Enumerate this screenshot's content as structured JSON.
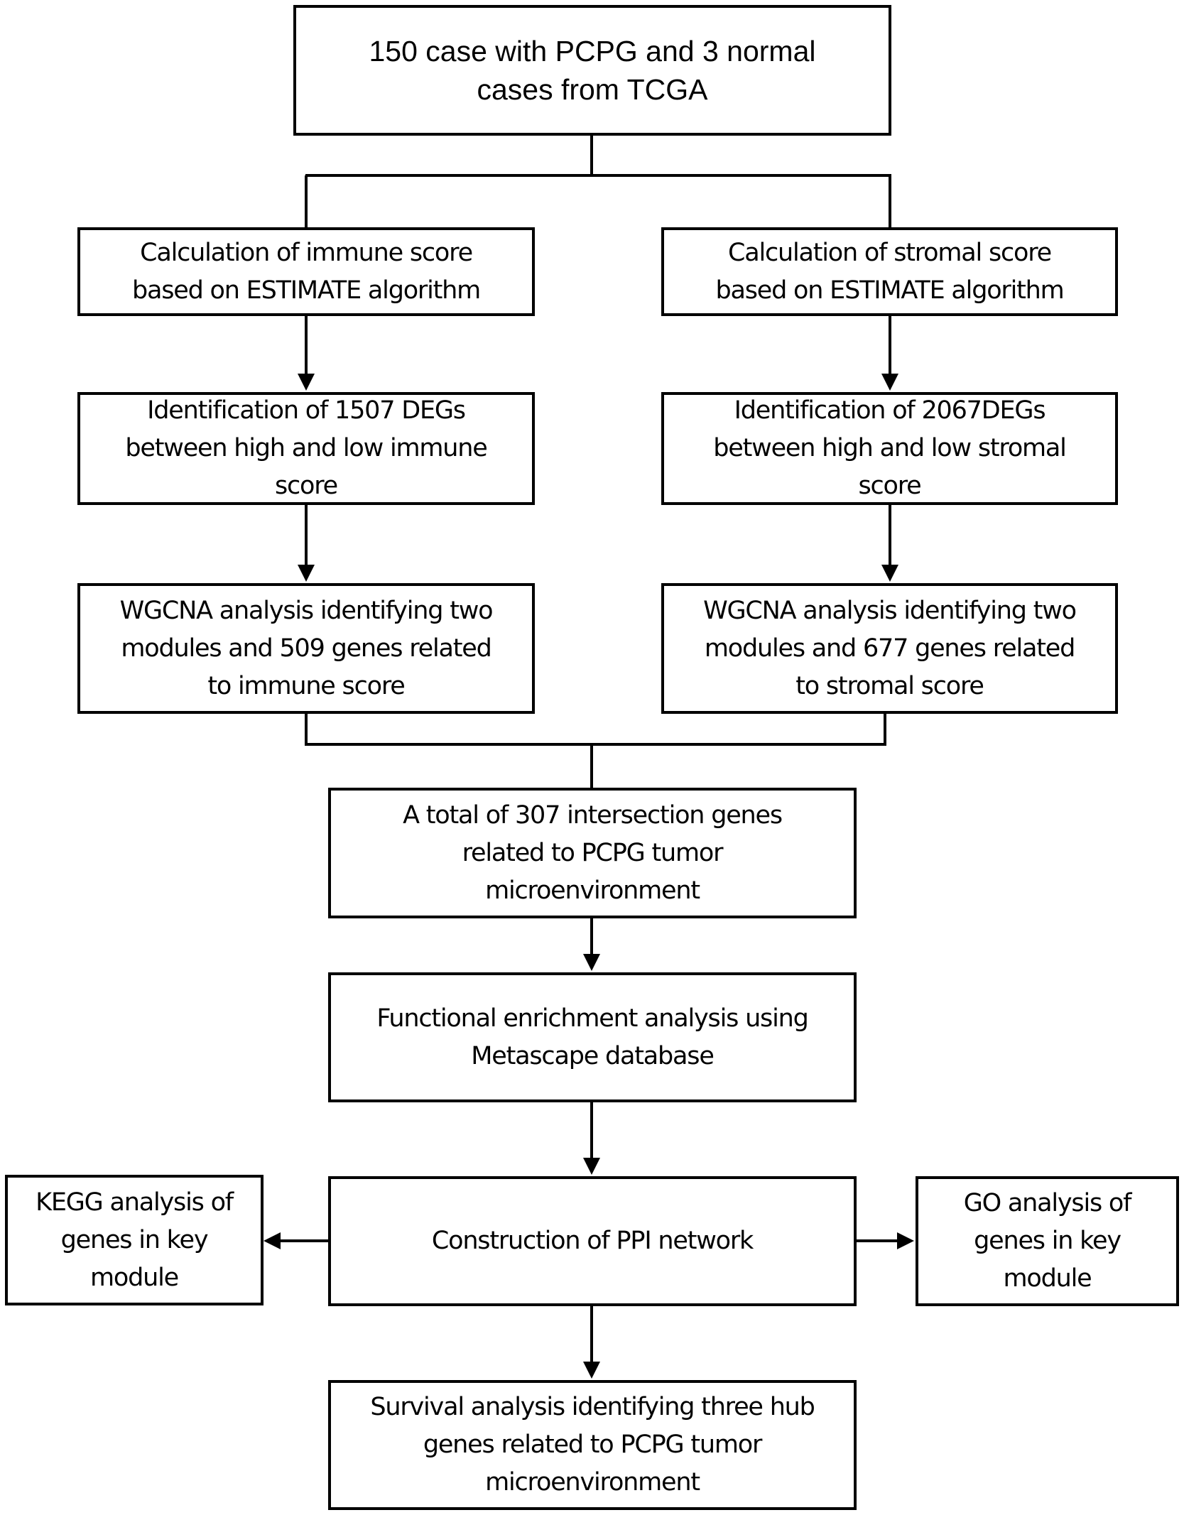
{
  "diagram": {
    "type": "flowchart",
    "nodes": {
      "source": "150 case with PCPG and 3 normal cases from TCGA",
      "immune_score": "Calculation of immune score based on ESTIMATE algorithm",
      "stromal_score": "Calculation of stromal score based on ESTIMATE algorithm",
      "immune_degs": "Identification of 1507 DEGs between high and low immune score",
      "stromal_degs": "Identification of 2067DEGs between high and low stromal score",
      "immune_wgcna": "WGCNA analysis identifying two modules and 509 genes related to immune score",
      "stromal_wgcna": "WGCNA analysis identifying two modules and 677 genes related to stromal score",
      "intersection": "A total of 307 intersection genes related to PCPG tumor microenvironment",
      "enrichment": "Functional enrichment analysis using Metascape database",
      "ppi": "Construction of PPI network",
      "kegg": "KEGG analysis of genes in key module",
      "go": "GO analysis of genes in key module",
      "survival": "Survival analysis identifying three hub genes related to PCPG tumor microenvironment"
    },
    "lines": {
      "source": [
        "150 case with PCPG and 3 normal",
        "cases from TCGA"
      ],
      "immune_score": [
        "Calculation of immune score",
        "based on ESTIMATE algorithm"
      ],
      "stromal_score": [
        "Calculation of stromal score",
        "based on ESTIMATE algorithm"
      ],
      "immune_degs": [
        "Identification of 1507 DEGs",
        "between high and low immune",
        "score"
      ],
      "stromal_degs": [
        "Identification of 2067DEGs",
        "between high and low stromal",
        "score"
      ],
      "immune_wgcna": [
        "WGCNA analysis identifying two",
        "modules and 509 genes related",
        "to immune score"
      ],
      "stromal_wgcna": [
        "WGCNA analysis identifying two",
        "modules and 677 genes related",
        "to stromal score"
      ],
      "intersection": [
        "A total of 307 intersection genes",
        "related to PCPG tumor",
        "microenvironment"
      ],
      "enrichment": [
        "Functional enrichment analysis using",
        "Metascape database"
      ],
      "ppi": [
        "Construction of PPI network"
      ],
      "kegg": [
        "KEGG analysis of",
        "genes in key",
        "module"
      ],
      "go": [
        "GO analysis of",
        "genes in key",
        "module"
      ],
      "survival": [
        "Survival analysis identifying three hub",
        "genes related to PCPG tumor",
        "microenvironment"
      ]
    },
    "edges": [
      {
        "from": "source",
        "to": "immune_score",
        "style": "line-branch"
      },
      {
        "from": "source",
        "to": "stromal_score",
        "style": "line-branch"
      },
      {
        "from": "immune_score",
        "to": "immune_degs",
        "style": "arrow"
      },
      {
        "from": "stromal_score",
        "to": "stromal_degs",
        "style": "arrow"
      },
      {
        "from": "immune_degs",
        "to": "immune_wgcna",
        "style": "arrow"
      },
      {
        "from": "stromal_degs",
        "to": "stromal_wgcna",
        "style": "arrow"
      },
      {
        "from": "immune_wgcna",
        "to": "intersection",
        "style": "line-merge"
      },
      {
        "from": "stromal_wgcna",
        "to": "intersection",
        "style": "line-merge"
      },
      {
        "from": "intersection",
        "to": "enrichment",
        "style": "arrow"
      },
      {
        "from": "enrichment",
        "to": "ppi",
        "style": "arrow"
      },
      {
        "from": "ppi",
        "to": "kegg",
        "style": "arrow"
      },
      {
        "from": "ppi",
        "to": "go",
        "style": "arrow"
      },
      {
        "from": "ppi",
        "to": "survival",
        "style": "arrow"
      }
    ],
    "colors": {
      "stroke": "#000000",
      "fill": "#ffffff",
      "text": "#000000"
    }
  }
}
